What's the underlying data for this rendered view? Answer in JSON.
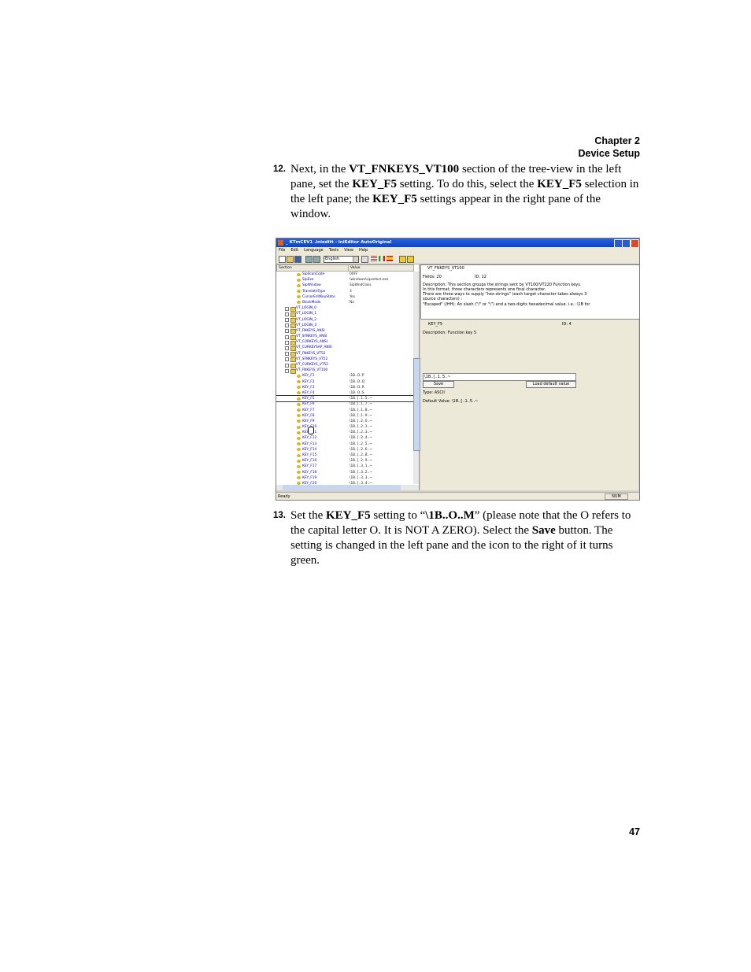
{
  "header": {
    "chapter": "Chapter 2",
    "section": "Device Setup"
  },
  "steps": [
    {
      "number": "12.",
      "parts": [
        {
          "t": "Next, in the ",
          "b": false
        },
        {
          "t": "VT_FNKEYS_VT100",
          "b": true
        },
        {
          "t": " section of the tree-view in the left pane, set the ",
          "b": false
        },
        {
          "t": "KEY_F5",
          "b": true
        },
        {
          "t": " setting. To do this, select the ",
          "b": false
        },
        {
          "t": "KEY_F5",
          "b": true
        },
        {
          "t": " selection in the left pane; the ",
          "b": false
        },
        {
          "t": "KEY_F5",
          "b": true
        },
        {
          "t": " settings appear in the right pane of the window.",
          "b": false
        }
      ]
    },
    {
      "number": "13.",
      "parts": [
        {
          "t": "Set the ",
          "b": false
        },
        {
          "t": "KEY_F5",
          "b": true
        },
        {
          "t": " setting to “",
          "b": false
        },
        {
          "t": "\\1B..O..M",
          "b": true
        },
        {
          "t": "” (please note that the O refers to the capital letter O. It is NOT A ZERO). Select the ",
          "b": false
        },
        {
          "t": "Save",
          "b": true
        },
        {
          "t": " button. The setting is changed in the left pane and the icon to the right of it turns green.",
          "b": false
        }
      ]
    }
  ],
  "page_number": "47",
  "screenshot": {
    "title": "_ KTmCEV1 .inieditt - iniEditor AutoOriginal",
    "menu": [
      "File",
      "Edit",
      "Language",
      "Tools",
      "View",
      "Help"
    ],
    "language": "English",
    "columns": {
      "section": "Section",
      "value": "Value"
    },
    "tree": [
      {
        "indent": 2,
        "type": "key",
        "name": "SipScanCode",
        "value": "00FF"
      },
      {
        "indent": 2,
        "type": "key",
        "name": "SipExe",
        "value": "\\windows\\sipselect.exe"
      },
      {
        "indent": 2,
        "type": "key",
        "name": "SipWindow",
        "value": "SipWndClass"
      },
      {
        "indent": 2,
        "type": "key",
        "name": "TranslateType",
        "value": "3"
      },
      {
        "indent": 2,
        "type": "key",
        "name": "CursorEditKeyState",
        "value": "Yes"
      },
      {
        "indent": 2,
        "type": "key",
        "name": "BlockMode",
        "value": "No"
      },
      {
        "indent": 1,
        "type": "folder",
        "name": "VT_LOGIN_0",
        "value": ""
      },
      {
        "indent": 1,
        "type": "folder",
        "name": "VT_LOGIN_1",
        "value": ""
      },
      {
        "indent": 1,
        "type": "folder",
        "name": "VT_LOGIN_2",
        "value": ""
      },
      {
        "indent": 1,
        "type": "folder",
        "name": "VT_LOGIN_3",
        "value": ""
      },
      {
        "indent": 1,
        "type": "folder",
        "name": "VT_FNKEYS_ANSI",
        "value": ""
      },
      {
        "indent": 1,
        "type": "folder",
        "name": "VT_SFNKEYS_ANSI",
        "value": ""
      },
      {
        "indent": 1,
        "type": "folder",
        "name": "VT_CURKEYS_ANSI",
        "value": ""
      },
      {
        "indent": 1,
        "type": "folder",
        "name": "VT_CURKEYSAP_ANSI",
        "value": ""
      },
      {
        "indent": 1,
        "type": "folder",
        "name": "VT_FNKEYS_VT52",
        "value": ""
      },
      {
        "indent": 1,
        "type": "folder",
        "name": "VT_SFNKEYS_VT52",
        "value": ""
      },
      {
        "indent": 1,
        "type": "folder",
        "name": "VT_CURKEYS_VT52",
        "value": ""
      },
      {
        "indent": 1,
        "type": "folder",
        "name": "VT_FNKEYS_VT100",
        "value": ""
      },
      {
        "indent": 2,
        "type": "key",
        "name": "KEY_F1",
        "value": "\\1B..O..P"
      },
      {
        "indent": 2,
        "type": "key",
        "name": "KEY_F2",
        "value": "\\1B..O..Q"
      },
      {
        "indent": 2,
        "type": "key",
        "name": "KEY_F3",
        "value": "\\1B..O..R"
      },
      {
        "indent": 2,
        "type": "key",
        "name": "KEY_F4",
        "value": "\\1B..O..S"
      },
      {
        "indent": 2,
        "type": "key",
        "name": "KEY_F5",
        "value": "\\1B..[..1..5..~",
        "selected": true
      },
      {
        "indent": 2,
        "type": "key",
        "name": "KEY_F6",
        "value": "\\1B..[..1..7..~"
      },
      {
        "indent": 2,
        "type": "key",
        "name": "KEY_F7",
        "value": "\\1B..[..1..8..~"
      },
      {
        "indent": 2,
        "type": "key",
        "name": "KEY_F8",
        "value": "\\1B..[..1..9..~"
      },
      {
        "indent": 2,
        "type": "key",
        "name": "KEY_F9",
        "value": "\\1B..[..2..0..~"
      },
      {
        "indent": 2,
        "type": "key",
        "name": "KEY_F10",
        "value": "\\1B..[..2..1..~"
      },
      {
        "indent": 2,
        "type": "key",
        "name": "KEY_F11",
        "value": "\\1B..[..2..3..~"
      },
      {
        "indent": 2,
        "type": "key",
        "name": "KEY_F12",
        "value": "\\1B..[..2..4..~"
      },
      {
        "indent": 2,
        "type": "key",
        "name": "KEY_F13",
        "value": "\\1B..[..2..5..~"
      },
      {
        "indent": 2,
        "type": "key",
        "name": "KEY_F14",
        "value": "\\1B..[..2..6..~"
      },
      {
        "indent": 2,
        "type": "key",
        "name": "KEY_F15",
        "value": "\\1B..[..2..8..~"
      },
      {
        "indent": 2,
        "type": "key",
        "name": "KEY_F16",
        "value": "\\1B..[..2..9..~"
      },
      {
        "indent": 2,
        "type": "key",
        "name": "KEY_F17",
        "value": "\\1B..[..3..1..~"
      },
      {
        "indent": 2,
        "type": "key",
        "name": "KEY_F18",
        "value": "\\1B..[..3..2..~"
      },
      {
        "indent": 2,
        "type": "key",
        "name": "KEY_F19",
        "value": "\\1B..[..3..3..~"
      },
      {
        "indent": 2,
        "type": "key",
        "name": "KEY_F20",
        "value": "\\1B..[..3..4..~"
      }
    ],
    "section_info": {
      "name": "VT_FNKEYS_VT100",
      "fields": "Fields: 20",
      "id": "ID: 12",
      "desc1": "Description: This section groups the strings sent by VT100/VT220 Function keys.",
      "desc2": "In this format, three characters represents one final character.",
      "desc3": "There are three ways to supply \"hex-strings\" (each target character takes always 3",
      "desc4": "source characters) :",
      "desc5": "\"Escaped\" (/HH): An slash (\"/\" or \"\\\") and a two-digits hexadecimal value. i.e.: \\1B for"
    },
    "key_info": {
      "name": "KEY_F5",
      "id": "ID: 4",
      "description": "Description: Function key 5",
      "value": "\\1B..[..1..5..~",
      "save_label": "Save",
      "load_default_label": "Load default value",
      "type": "Type: ASCII",
      "default_value": "Default Value: \\1B..[..1..5..~"
    },
    "status": {
      "ready": "Ready",
      "num": "NUM"
    }
  }
}
